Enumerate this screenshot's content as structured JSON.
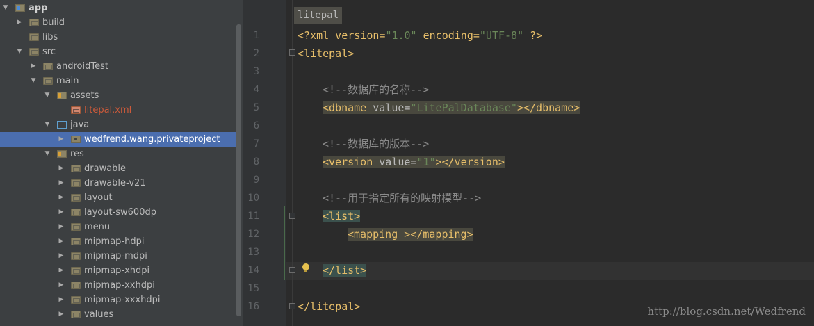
{
  "tree": [
    {
      "label": "app",
      "depth": 0,
      "arrow": "open",
      "icon": "app",
      "bold": true
    },
    {
      "label": "build",
      "depth": 1,
      "arrow": "closed",
      "icon": "folder"
    },
    {
      "label": "libs",
      "depth": 1,
      "arrow": "none",
      "icon": "folder"
    },
    {
      "label": "src",
      "depth": 1,
      "arrow": "open",
      "icon": "folder"
    },
    {
      "label": "androidTest",
      "depth": 2,
      "arrow": "closed",
      "icon": "folder"
    },
    {
      "label": "main",
      "depth": 2,
      "arrow": "open",
      "icon": "folder"
    },
    {
      "label": "assets",
      "depth": 3,
      "arrow": "open",
      "icon": "res"
    },
    {
      "label": "litepal.xml",
      "depth": 4,
      "arrow": "none",
      "icon": "xml",
      "red": true
    },
    {
      "label": "java",
      "depth": 3,
      "arrow": "open",
      "icon": "java"
    },
    {
      "label": "wedfrend.wang.privateproject",
      "depth": 4,
      "arrow": "closed",
      "icon": "pkg",
      "selected": true
    },
    {
      "label": "res",
      "depth": 3,
      "arrow": "open",
      "icon": "res"
    },
    {
      "label": "drawable",
      "depth": 4,
      "arrow": "closed",
      "icon": "folder"
    },
    {
      "label": "drawable-v21",
      "depth": 4,
      "arrow": "closed",
      "icon": "folder"
    },
    {
      "label": "layout",
      "depth": 4,
      "arrow": "closed",
      "icon": "folder"
    },
    {
      "label": "layout-sw600dp",
      "depth": 4,
      "arrow": "closed",
      "icon": "folder"
    },
    {
      "label": "menu",
      "depth": 4,
      "arrow": "closed",
      "icon": "folder"
    },
    {
      "label": "mipmap-hdpi",
      "depth": 4,
      "arrow": "closed",
      "icon": "folder"
    },
    {
      "label": "mipmap-mdpi",
      "depth": 4,
      "arrow": "closed",
      "icon": "folder"
    },
    {
      "label": "mipmap-xhdpi",
      "depth": 4,
      "arrow": "closed",
      "icon": "folder"
    },
    {
      "label": "mipmap-xxhdpi",
      "depth": 4,
      "arrow": "closed",
      "icon": "folder"
    },
    {
      "label": "mipmap-xxxhdpi",
      "depth": 4,
      "arrow": "closed",
      "icon": "folder"
    },
    {
      "label": "values",
      "depth": 4,
      "arrow": "closed",
      "icon": "folder"
    }
  ],
  "editor": {
    "breadcrumb": "litepal",
    "line_numbers": [
      "1",
      "2",
      "3",
      "4",
      "5",
      "6",
      "7",
      "8",
      "9",
      "10",
      "11",
      "12",
      "13",
      "14",
      "15",
      "16"
    ],
    "code": {
      "l1": {
        "a": "<?xml version=",
        "b": "\"1.0\"",
        "c": " encoding=",
        "d": "\"UTF-8\"",
        "e": " ?>"
      },
      "l2": {
        "a": "<litepal>"
      },
      "l4": {
        "a": "<!--数据库的名称-->"
      },
      "l5": {
        "a": "<dbname",
        "b": " value=",
        "c": "\"LitePalDatabase\"",
        "d": "></dbname>"
      },
      "l7": {
        "a": "<!--数据库的版本-->"
      },
      "l8": {
        "a": "<version",
        "b": " value=",
        "c": "\"1\"",
        "d": "></version>"
      },
      "l10": {
        "a": "<!--用于指定所有的映射模型-->"
      },
      "l11": {
        "a": "<list>"
      },
      "l12": {
        "a": "<mapping ></mapping>"
      },
      "l14": {
        "a": "</list>"
      },
      "l16": {
        "a": "</litepal>"
      }
    }
  },
  "watermark": "http://blog.csdn.net/Wedfrend"
}
